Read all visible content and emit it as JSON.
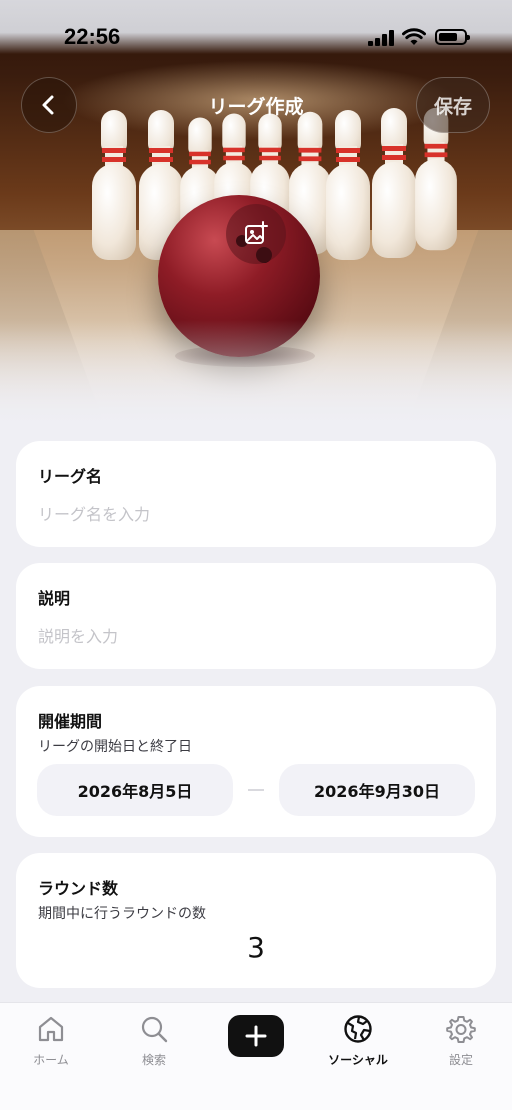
{
  "status_bar": {
    "time": "22:56"
  },
  "nav": {
    "title": "リーグ作成",
    "save_label": "保存"
  },
  "form": {
    "league_name": {
      "label": "リーグ名",
      "placeholder": "リーグ名を入力"
    },
    "description": {
      "label": "説明",
      "placeholder": "説明を入力"
    },
    "period": {
      "label": "開催期間",
      "sub": "リーグの開始日と終了日",
      "start": "2026年8月5日",
      "end": "2026年9月30日"
    },
    "rounds": {
      "label": "ラウンド数",
      "sub": "期間中に行うラウンドの数",
      "value": "3"
    }
  },
  "tabs": [
    {
      "label": "ホーム",
      "icon": "home-icon",
      "active": false
    },
    {
      "label": "検索",
      "icon": "search-icon",
      "active": false
    },
    {
      "label": "",
      "icon": "plus-icon",
      "active": false
    },
    {
      "label": "ソーシャル",
      "icon": "globe-icon",
      "active": true
    },
    {
      "label": "設定",
      "icon": "gear-icon",
      "active": false
    }
  ],
  "colors": {
    "background": "#efeff4",
    "card": "#ffffff",
    "pill": "#f2f2f7",
    "ball": "#8e1c26",
    "pin_stripe": "#d8322a"
  }
}
